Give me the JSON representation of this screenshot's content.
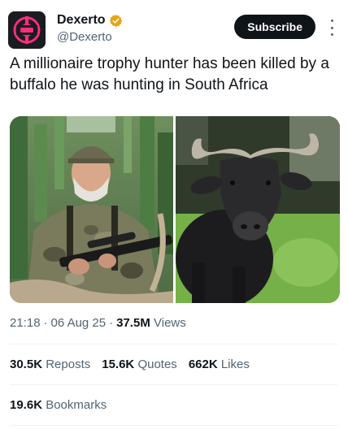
{
  "author": {
    "name": "Dexerto",
    "handle": "@Dexerto",
    "verified_color": "#e8a317",
    "avatar_icon": "dexerto-logo-icon"
  },
  "subscribe_label": "Subscribe",
  "tweet": {
    "text": "A millionaire trophy hunter has been killed by a buffalo he was hunting in South Africa"
  },
  "media": {
    "left_photo": "hunter-photo",
    "right_photo": "buffalo-photo"
  },
  "meta": {
    "time": "21:18",
    "date": "06 Aug 25",
    "views_count": "37.5M",
    "views_label": "Views"
  },
  "stats": {
    "reposts_count": "30.5K",
    "reposts_label": "Reposts",
    "quotes_count": "15.6K",
    "quotes_label": "Quotes",
    "likes_count": "662K",
    "likes_label": "Likes",
    "bookmarks_count": "19.6K",
    "bookmarks_label": "Bookmarks"
  },
  "colors": {
    "text_primary": "#0f1419",
    "text_secondary": "#536471",
    "avatar_accent": "#ff2d7a"
  }
}
